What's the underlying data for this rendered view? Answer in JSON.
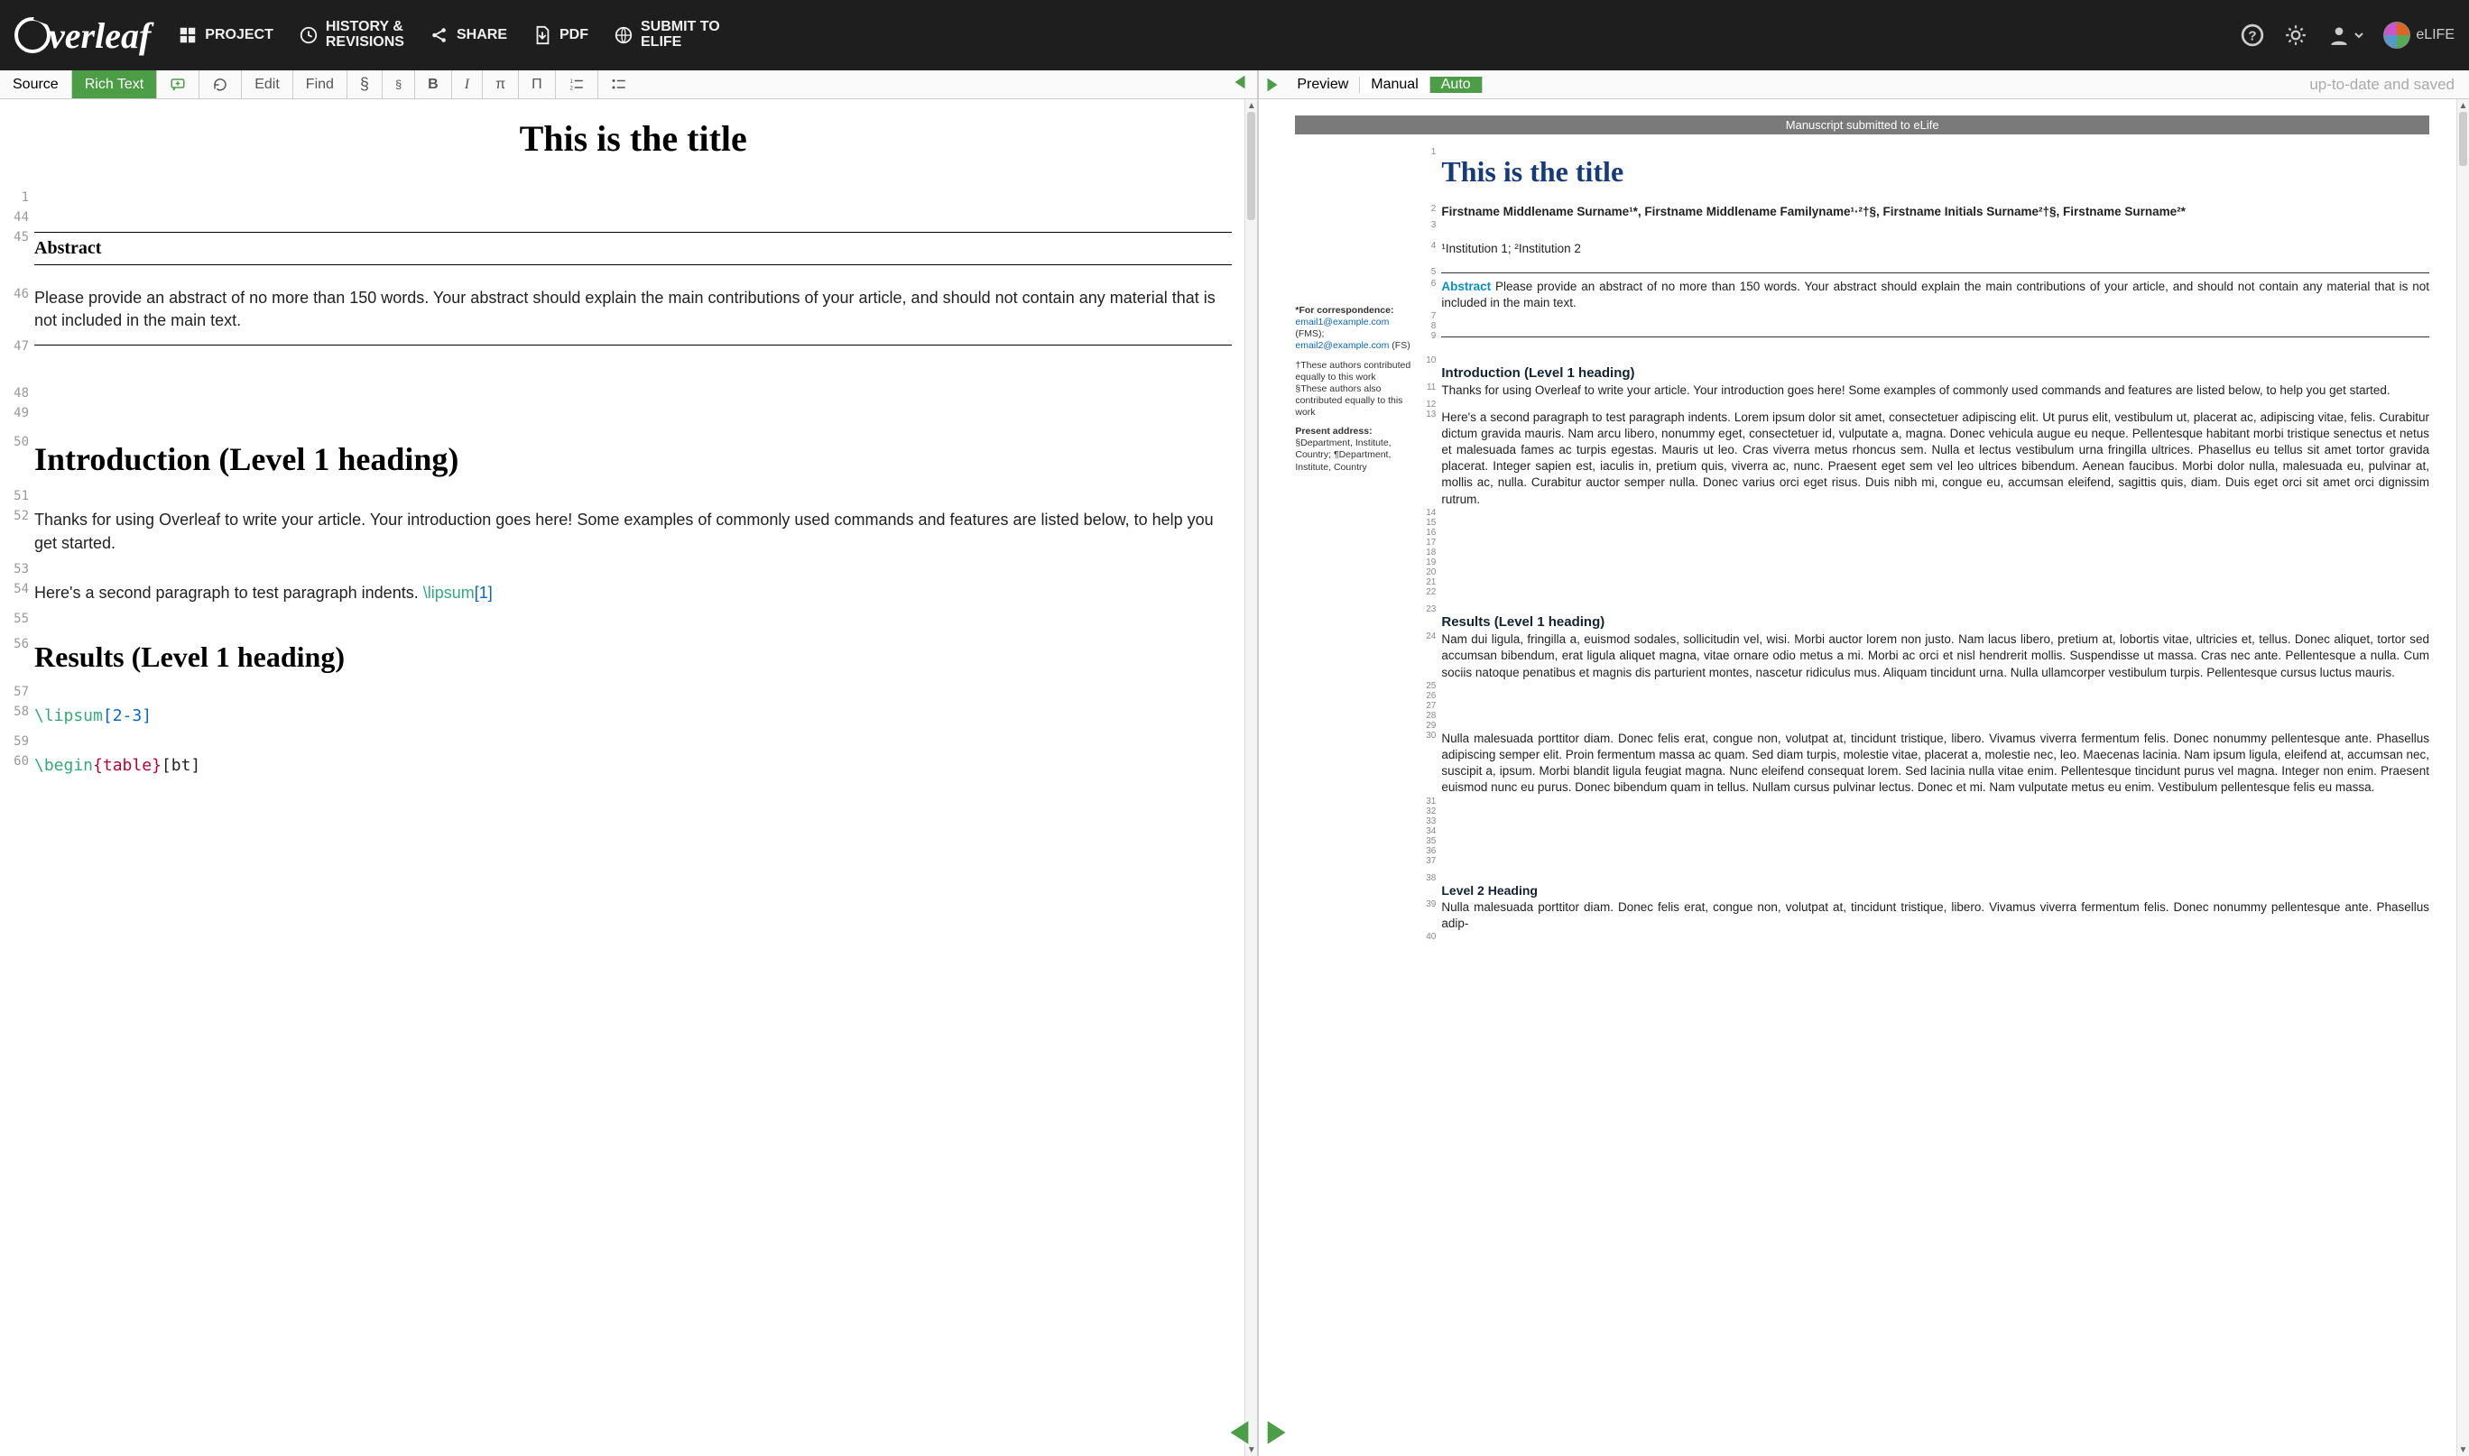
{
  "topbar": {
    "logo_text": "verleaf",
    "nav": {
      "project": "PROJECT",
      "history_l1": "HISTORY &",
      "history_l2": "REVISIONS",
      "share": "SHARE",
      "pdf": "PDF",
      "submit_l1": "SUBMIT TO",
      "submit_l2": "ELIFE"
    },
    "elife": "eLIFE"
  },
  "toolbar": {
    "source": "Source",
    "richtext": "Rich Text",
    "edit": "Edit",
    "find": "Find",
    "section": "§",
    "subsection": "§",
    "bold": "B",
    "italic": "I",
    "math_pi": "π",
    "math_Pi": "Π",
    "numlist_icon": "numbered-list",
    "bullist_icon": "bullet-list",
    "preview": "Preview",
    "manual": "Manual",
    "auto": "Auto",
    "status": "up-to-date and saved"
  },
  "editor": {
    "title": "This is the title",
    "lines": {
      "l1": "1",
      "l44": "44",
      "l45": "45",
      "l46": "46",
      "l47": "47",
      "l48": "48",
      "l49": "49",
      "l50": "50",
      "l51": "51",
      "l52": "52",
      "l53": "53",
      "l54": "54",
      "l55": "55",
      "l56": "56",
      "l57": "57",
      "l58": "58",
      "l59": "59",
      "l60": "60"
    },
    "abstract_h": "Abstract",
    "abstract_p": "Please provide an abstract of no more than 150 words. Your abstract should explain the main contributions of your article, and should not contain any material that is not included in the main text.",
    "intro_h": "Introduction (Level 1 heading)",
    "intro_p": "Thanks for using Overleaf to write your article. Your introduction goes here! Some examples of commonly used commands and features are listed below, to help you get started.",
    "para2_pre": "Here's a second paragraph to test paragraph indents. ",
    "lipsum_cmd": "\\lipsum",
    "lipsum_arg1": "[1]",
    "results_h": "Results (Level 1 heading)",
    "lipsum_arg2": "[2-3]",
    "begin_cmd": "\\begin",
    "begin_brace_l": "{",
    "begin_env": "table",
    "begin_brace_r": "}",
    "begin_opt": "[bt]"
  },
  "preview": {
    "bar": "Manuscript submitted to eLife",
    "title": "This is the title",
    "ln": {
      "l1": "1",
      "l2": "2",
      "l3": "3",
      "l4": "4",
      "l5": "5",
      "l6": "6",
      "l7": "7",
      "l8": "8",
      "l9": "9",
      "l10": "10",
      "l11": "11",
      "l12": "12",
      "l13": "13",
      "l14": "14",
      "l15": "15",
      "l16": "16",
      "l17": "17",
      "l18": "18",
      "l19": "19",
      "l20": "20",
      "l21": "21",
      "l22": "22",
      "l23": "23",
      "l24": "24",
      "l25": "25",
      "l26": "26",
      "l27": "27",
      "l28": "28",
      "l29": "29",
      "l30": "30",
      "l31": "31",
      "l32": "32",
      "l33": "33",
      "l34": "34",
      "l35": "35",
      "l36": "36",
      "l37": "37",
      "l38": "38",
      "l39": "39",
      "l40": "40"
    },
    "authors": "Firstname Middlename Surname¹*, Firstname Middlename Familyname¹·²†§, Firstname Initials Surname²†§, Firstname Surname²*",
    "affil": "¹Institution 1; ²Institution 2",
    "side": {
      "corr_h": "*For correspondence:",
      "e1": "email1@example.com",
      "e1s": " (FMS);",
      "e2": "email2@example.com",
      "e2s": " (FS)",
      "t1": "†These authors contributed equally to this work",
      "t2": "§These authors also contributed equally to this work",
      "pa_h": "Present address: ",
      "pa": "§Department, Institute, Country; ¶Department, Institute, Country"
    },
    "abs_label": "Abstract",
    "abs_text": "   Please provide an abstract of no more than 150 words. Your abstract should explain the main contributions of your article, and should not contain any material that is not included in the main text.",
    "intro_h": "Introduction (Level 1 heading)",
    "intro_p1": "Thanks for using Overleaf to write your article. Your introduction goes here! Some examples of commonly used commands and features are listed below, to help you get started.",
    "intro_p2": "   Here's a second paragraph to test paragraph indents. Lorem ipsum dolor sit amet, consectetuer adipiscing elit. Ut purus elit, vestibulum ut, placerat ac, adipiscing vitae, felis. Curabitur dictum gravida mauris. Nam arcu libero, nonummy eget, consectetuer id, vulputate a, magna. Donec vehicula augue eu neque. Pellentesque habitant morbi tristique senectus et netus et malesuada fames ac turpis egestas. Mauris ut leo. Cras viverra metus rhoncus sem. Nulla et lectus vestibulum urna fringilla ultrices. Phasellus eu tellus sit amet tortor gravida placerat. Integer sapien est, iaculis in, pretium quis, viverra ac, nunc. Praesent eget sem vel leo ultrices bibendum. Aenean faucibus. Morbi dolor nulla, malesuada eu, pulvinar at, mollis ac, nulla. Curabitur auctor semper nulla. Donec varius orci eget risus. Duis nibh mi, congue eu, accumsan eleifend, sagittis quis, diam. Duis eget orci sit amet orci dignissim rutrum.",
    "results_h": "Results (Level 1 heading)",
    "results_p1": "Nam dui ligula, fringilla a, euismod sodales, sollicitudin vel, wisi. Morbi auctor lorem non justo. Nam lacus libero, pretium at, lobortis vitae, ultricies et, tellus. Donec aliquet, tortor sed accumsan bibendum, erat ligula aliquet magna, vitae ornare odio metus a mi. Morbi ac orci et nisl hendrerit mollis. Suspendisse ut massa. Cras nec ante. Pellentesque a nulla. Cum sociis natoque penatibus et magnis dis parturient montes, nascetur ridiculus mus. Aliquam tincidunt urna. Nulla ullamcorper vestibulum turpis. Pellentesque cursus luctus mauris.",
    "results_p2": "   Nulla malesuada porttitor diam. Donec felis erat, congue non, volutpat at, tincidunt tristique, libero. Vivamus viverra fermentum felis. Donec nonummy pellentesque ante. Phasellus adipiscing semper elit. Proin fermentum massa ac quam. Sed diam turpis, molestie vitae, placerat a, molestie nec, leo. Maecenas lacinia. Nam ipsum ligula, eleifend at, accumsan nec, suscipit a, ipsum. Morbi blandit ligula feugiat magna. Nunc eleifend consequat lorem. Sed lacinia nulla vitae enim. Pellentesque tincidunt purus vel magna. Integer non enim. Praesent euismod nunc eu purus. Donec bibendum quam in tellus. Nullam cursus pulvinar lectus. Donec et mi. Nam vulputate metus eu enim. Vestibulum pellentesque felis eu massa.",
    "l2h": "Level 2 Heading",
    "l2p": "Nulla malesuada porttitor diam. Donec felis erat, congue non, volutpat at, tincidunt tristique, libero. Vivamus viverra fermentum felis. Donec nonummy pellentesque ante. Phasellus adip-"
  }
}
